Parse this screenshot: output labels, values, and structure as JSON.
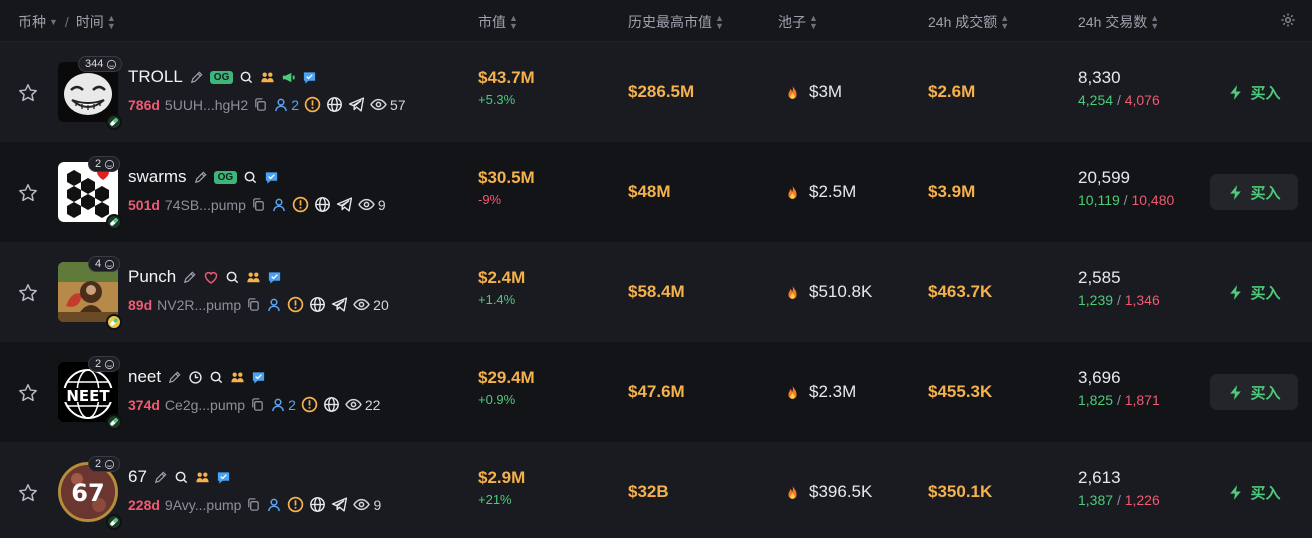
{
  "header": {
    "col_token": "币种",
    "col_time": "时间",
    "col_mcap": "市值",
    "col_ath": "历史最高市值",
    "col_pool": "池子",
    "col_vol": "24h 成交额",
    "col_tx": "24h 交易数"
  },
  "colors": {
    "accent_green": "#4ccb7a",
    "accent_red": "#f05a73",
    "value_gold": "#f5b14c"
  },
  "rows": [
    {
      "name": "TROLL",
      "count": "344",
      "og": "OG",
      "age": "786d",
      "address": "5UUH...hgH2",
      "holders": "2",
      "views": "57",
      "mcap": "$43.7M",
      "change": "+5.3%",
      "ath": "$286.5M",
      "pool": "$3M",
      "volume": "$2.6M",
      "tx_total": "8,330",
      "buys": "4,254",
      "sells": "4,076",
      "buy_label": "买入"
    },
    {
      "name": "swarms",
      "count": "2",
      "og": "OG",
      "age": "501d",
      "address": "74SB...pump",
      "holders": "",
      "views": "9",
      "mcap": "$30.5M",
      "change": "-9%",
      "ath": "$48M",
      "pool": "$2.5M",
      "volume": "$3.9M",
      "tx_total": "20,599",
      "buys": "10,119",
      "sells": "10,480",
      "buy_label": "买入"
    },
    {
      "name": "Punch",
      "count": "4",
      "og": "",
      "age": "89d",
      "address": "NV2R...pump",
      "holders": "",
      "views": "20",
      "mcap": "$2.4M",
      "change": "+1.4%",
      "ath": "$58.4M",
      "pool": "$510.8K",
      "volume": "$463.7K",
      "tx_total": "2,585",
      "buys": "1,239",
      "sells": "1,346",
      "buy_label": "买入"
    },
    {
      "name": "neet",
      "count": "2",
      "og": "",
      "age": "374d",
      "address": "Ce2g...pump",
      "holders": "2",
      "views": "22",
      "mcap": "$29.4M",
      "change": "+0.9%",
      "ath": "$47.6M",
      "pool": "$2.3M",
      "volume": "$455.3K",
      "tx_total": "3,696",
      "buys": "1,825",
      "sells": "1,871",
      "buy_label": "买入"
    },
    {
      "name": "67",
      "count": "2",
      "og": "",
      "age": "228d",
      "address": "9Avy...pump",
      "holders": "",
      "views": "9",
      "mcap": "$2.9M",
      "change": "+21%",
      "ath": "$32B",
      "pool": "$396.5K",
      "volume": "$350.1K",
      "tx_total": "2,613",
      "buys": "1,387",
      "sells": "1,226",
      "buy_label": "买入"
    }
  ]
}
